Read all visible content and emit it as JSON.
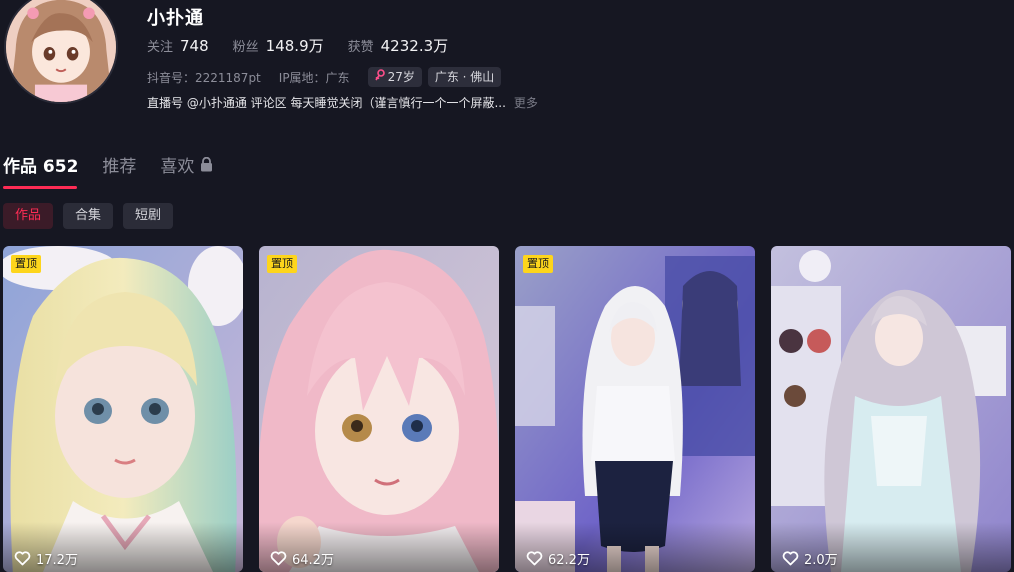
{
  "profile": {
    "name": "小扑通",
    "stats": [
      {
        "label": "关注",
        "value": "748"
      },
      {
        "label": "粉丝",
        "value": "148.9万"
      },
      {
        "label": "获赞",
        "value": "4232.3万"
      }
    ],
    "douyin_id": "抖音号：2221187pt",
    "ip_location": "IP属地：广东",
    "age_chip": "27岁",
    "region_chip": "广东 · 佛山",
    "bio": "直播号 @小扑通通 评论区 每天睡觉关闭（谨言慎行一个一个屏蔽...",
    "bio_more": "更多"
  },
  "tabs": [
    {
      "label": "作品 652"
    },
    {
      "label": "推荐"
    },
    {
      "label": "喜欢"
    }
  ],
  "filters": [
    {
      "label": "作品"
    },
    {
      "label": "合集"
    },
    {
      "label": "短剧"
    }
  ],
  "videos": [
    {
      "pinned": "置顶",
      "likes": "17.2万"
    },
    {
      "pinned": "置顶",
      "likes": "64.2万"
    },
    {
      "pinned": "置顶",
      "likes": "62.2万"
    },
    {
      "pinned": "",
      "likes": "2.0万"
    }
  ],
  "colors": {
    "background": "#161722",
    "accent": "#fe2c55",
    "pin_badge": "#fdd51c",
    "gender_female": "#ff4f8b"
  },
  "icons": {
    "lock": "lock-icon",
    "heart": "heart-icon",
    "gender": "female-gender-icon"
  }
}
